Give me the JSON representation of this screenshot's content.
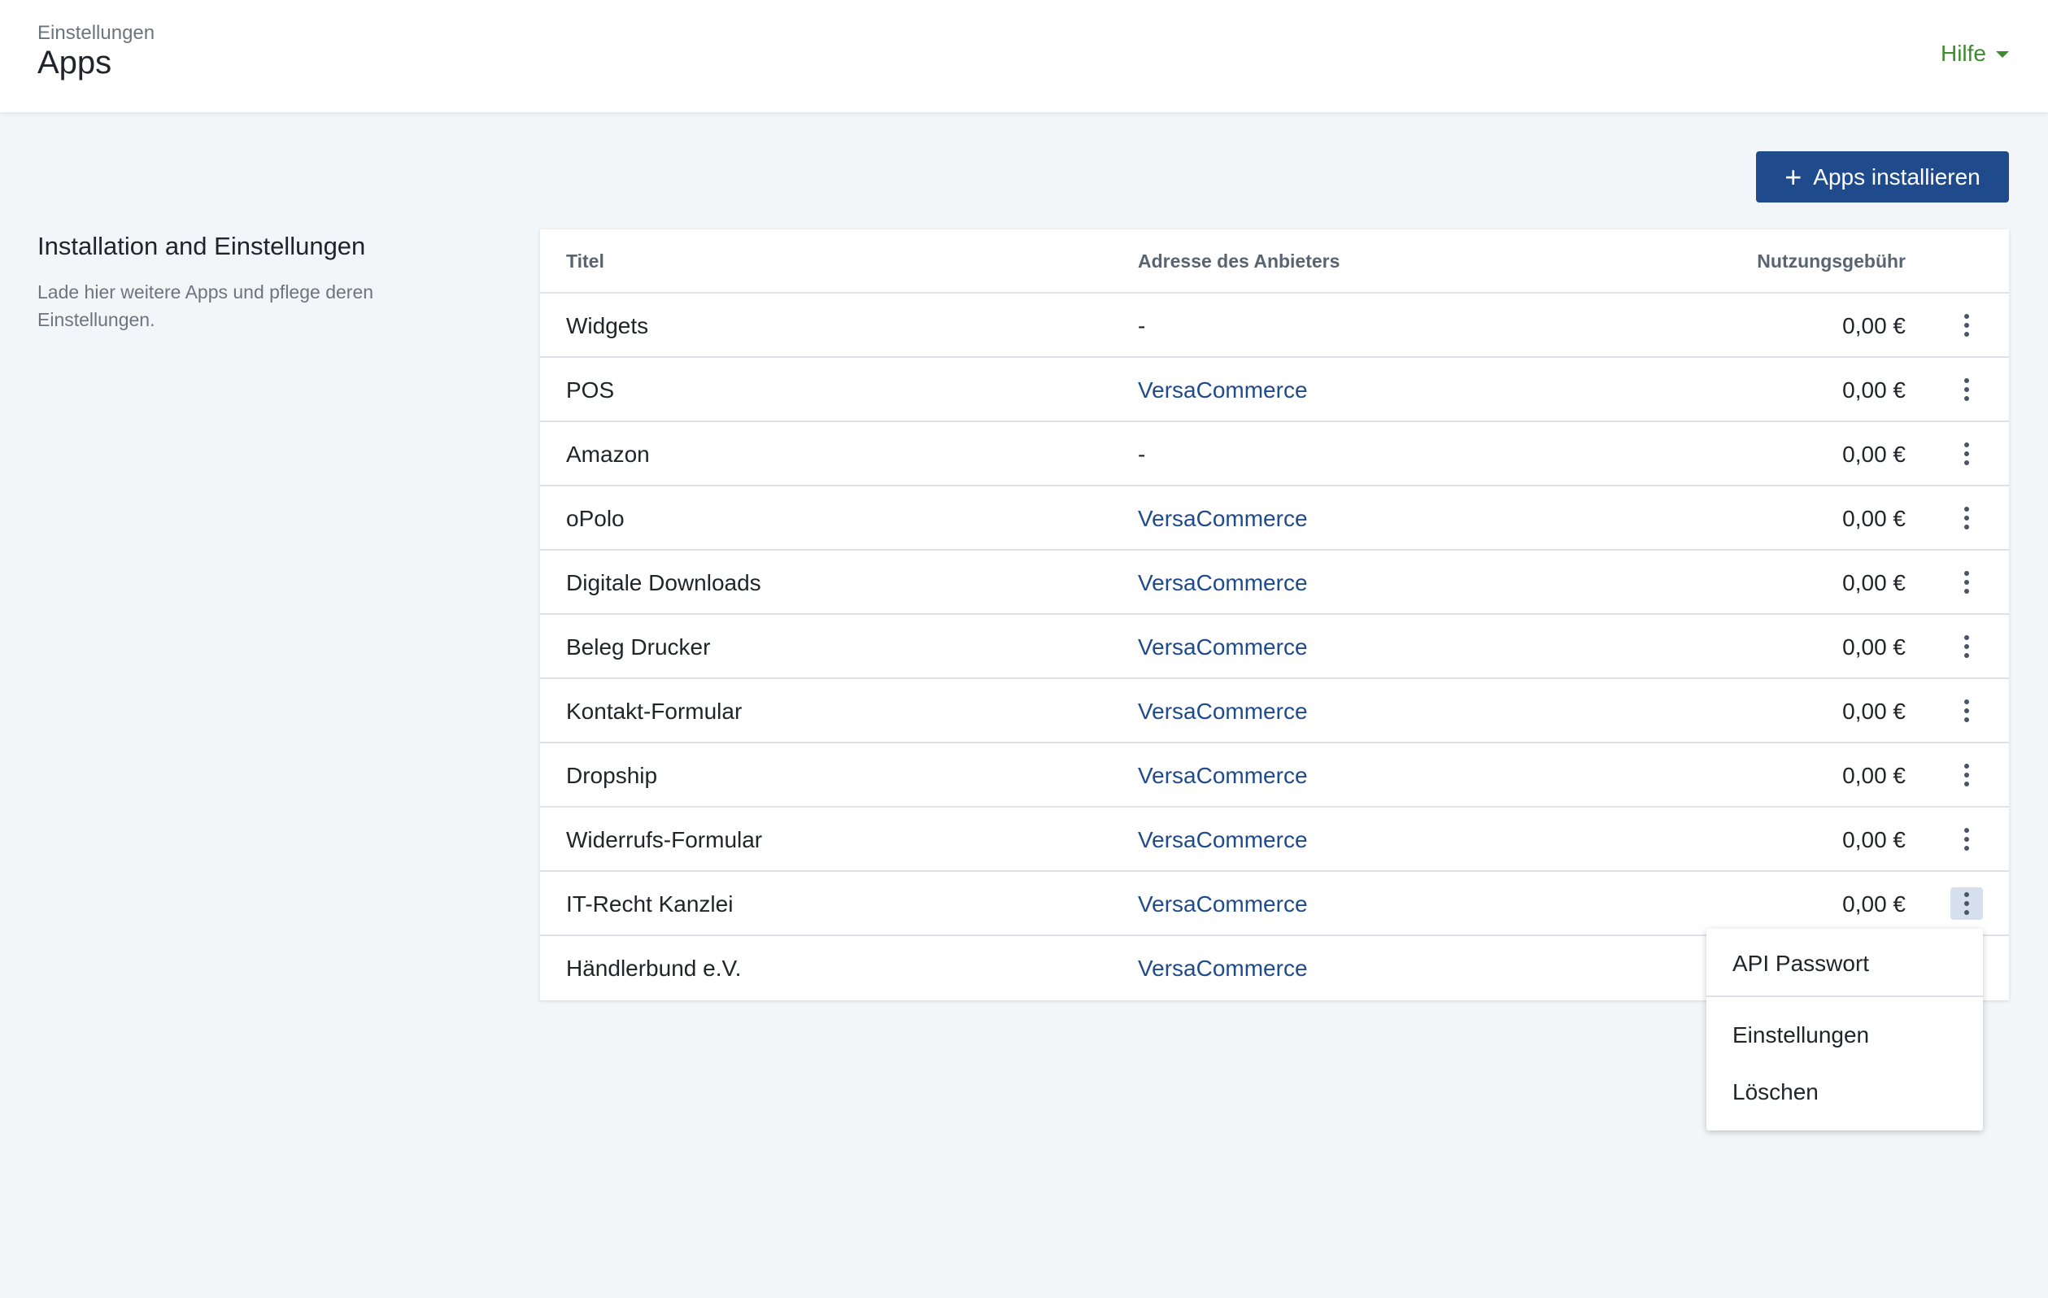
{
  "header": {
    "breadcrumb": "Einstellungen",
    "title": "Apps",
    "help_label": "Hilfe"
  },
  "actions": {
    "install_label": "Apps installieren"
  },
  "section": {
    "title": "Installation and Einstellungen",
    "description": "Lade hier weitere Apps und pflege deren Einstellungen."
  },
  "table": {
    "columns": {
      "title": "Titel",
      "provider": "Adresse des Anbieters",
      "fee": "Nutzungsgebühr"
    },
    "rows": [
      {
        "title": "Widgets",
        "provider": "-",
        "fee": "0,00 €"
      },
      {
        "title": "POS",
        "provider": "VersaCommerce",
        "fee": "0,00 €"
      },
      {
        "title": "Amazon",
        "provider": "-",
        "fee": "0,00 €"
      },
      {
        "title": "oPolo",
        "provider": "VersaCommerce",
        "fee": "0,00 €"
      },
      {
        "title": "Digitale Downloads",
        "provider": "VersaCommerce",
        "fee": "0,00 €"
      },
      {
        "title": "Beleg Drucker",
        "provider": "VersaCommerce",
        "fee": "0,00 €"
      },
      {
        "title": "Kontakt-Formular",
        "provider": "VersaCommerce",
        "fee": "0,00 €"
      },
      {
        "title": "Dropship",
        "provider": "VersaCommerce",
        "fee": "0,00 €"
      },
      {
        "title": "Widerrufs-Formular",
        "provider": "VersaCommerce",
        "fee": "0,00 €"
      },
      {
        "title": "IT-Recht Kanzlei",
        "provider": "VersaCommerce",
        "fee": "0,00 €"
      },
      {
        "title": "Händlerbund e.V.",
        "provider": "VersaCommerce",
        "fee": ""
      }
    ]
  },
  "context_menu": {
    "open_for_row": 9,
    "items": [
      "API Passwort",
      "Einstellungen",
      "Löschen"
    ]
  },
  "colors": {
    "accent": "#1f4a8c",
    "help": "#3d8c2f",
    "background": "#f3f6f9"
  }
}
